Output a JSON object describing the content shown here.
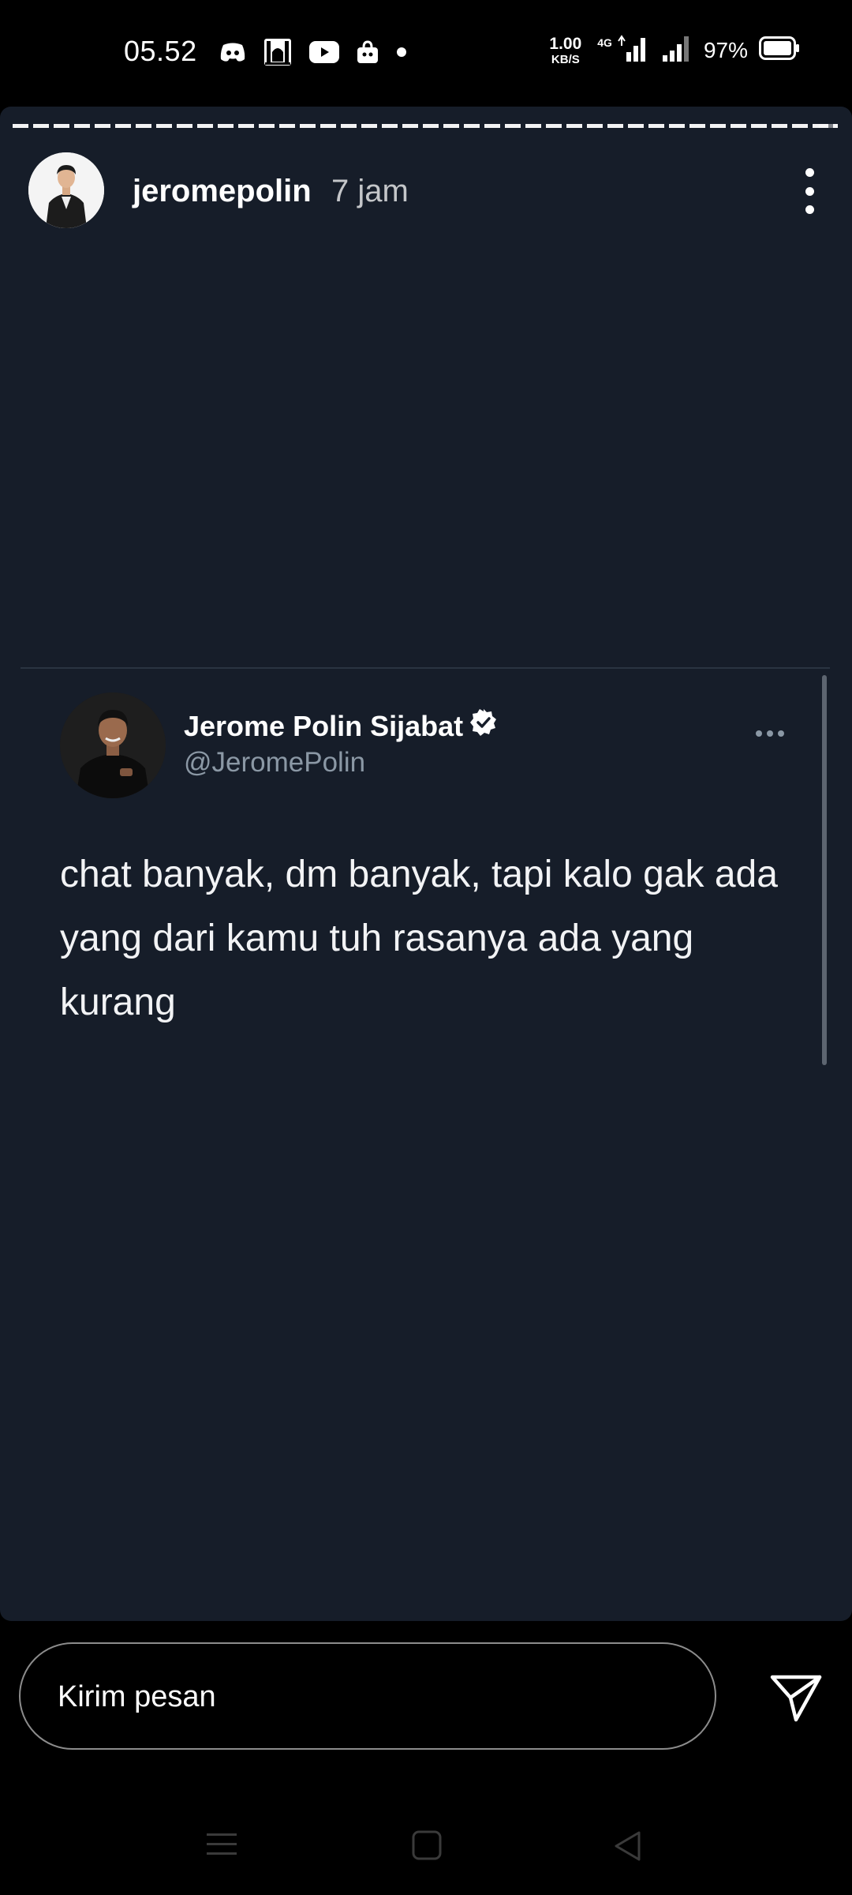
{
  "status_bar": {
    "time": "05.52",
    "net_speed_value": "1.00",
    "net_speed_unit": "KB/S",
    "network_type": "4G",
    "battery_percent": "97%",
    "notification_icons": [
      "discord-icon",
      "mosque-app-icon",
      "youtube-icon",
      "shopee-icon",
      "dot-icon"
    ]
  },
  "story": {
    "username": "jeromepolin",
    "time_ago": "7 jam",
    "progress_segments": 37
  },
  "tweet": {
    "display_name": "Jerome Polin Sijabat",
    "handle": "@JeromePolin",
    "verified": true,
    "text": "chat banyak, dm banyak, tapi kalo gak ada yang dari kamu tuh rasanya ada yang kurang"
  },
  "reply": {
    "placeholder": "Kirim pesan"
  },
  "colors": {
    "story_background": "#161d29",
    "handle_gray": "#8b98a5",
    "background": "#000000"
  }
}
